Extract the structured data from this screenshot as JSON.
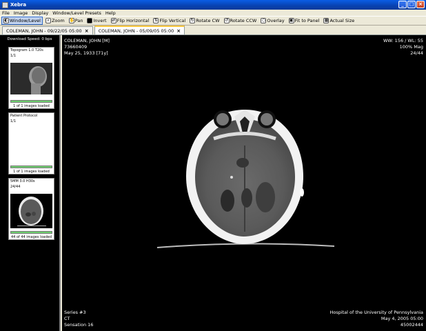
{
  "window": {
    "title": "Xebra"
  },
  "menu": [
    "File",
    "Image",
    "Display",
    "Window/Level Presets",
    "Help"
  ],
  "toolbar": {
    "window_level": "Window/Level",
    "zoom": "Zoom",
    "pan": "Pan",
    "invert": "Invert",
    "flip_horizontal": "Flip Horizontal",
    "flip_vertical": "Flip Vertical",
    "rotate_cw": "Rotate CW",
    "rotate_ccw": "Rotate CCW",
    "overlay": "Overlay",
    "fit_to_panel": "Fit to Panel",
    "actual_size": "Actual Size"
  },
  "tabs": [
    {
      "label": "COLEMAN, JOHN - 09/22/05 05:00",
      "close": "×"
    },
    {
      "label": "COLEMAN, JOHN - 05/09/05 05:00",
      "close": "×"
    }
  ],
  "sidebar": {
    "download_speed": "Download Speed: 0 bps",
    "series": [
      {
        "title": "Topogram  1.0  T20s",
        "sub": "1/1",
        "loaded": "1 of 1 images loaded",
        "progress": 1.0
      },
      {
        "title": "Patient Protocol",
        "sub": "1/1",
        "loaded": "1 of 1 images loaded",
        "progress": 1.0
      },
      {
        "title": "5MM  3.0  H30s",
        "sub": "24/44",
        "loaded": "44 of 44 images loaded",
        "progress": 1.0
      }
    ]
  },
  "overlay": {
    "patient_name": "COLEMAN, JOHN [M]",
    "patient_id": "73660409",
    "dob": "May 25, 1933 [71y]",
    "window_level": "WW: 156 / WL: 55",
    "zoom": "100% Mag",
    "image_index": "24/44",
    "series": "Series #3",
    "modality": "CT",
    "scanner": "Sensation 16",
    "institution": "Hospital of the University of Pennsylvania",
    "study_date": "May 4, 2005 05:00",
    "accession": "45002444"
  }
}
